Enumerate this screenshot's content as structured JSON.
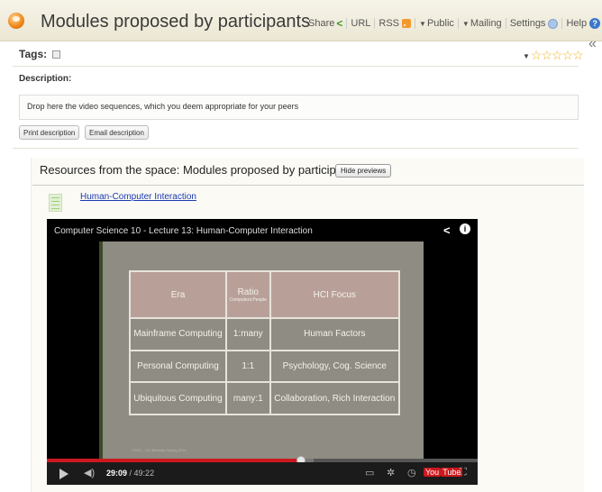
{
  "header": {
    "title": "Modules proposed by participants",
    "toolbar": {
      "share": "Share",
      "url": "URL",
      "rss": "RSS",
      "public": "Public",
      "mailing": "Mailing",
      "settings": "Settings",
      "help": "Help"
    }
  },
  "tags": {
    "label": "Tags:"
  },
  "rating": {
    "stars_filled": 0,
    "stars_total": 5
  },
  "description": {
    "label": "Description:",
    "text": "Drop here the video sequences, which you deem appropriate for your peers",
    "print_button": "Print description",
    "email_button": "Email description"
  },
  "resources": {
    "title": "Resources from the space: Modules proposed by participants",
    "hide_previews_button": "Hide previews",
    "item_link": "Human-Computer Interaction"
  },
  "video": {
    "title": "Computer Science 10 - Lecture 13: Human-Computer Interaction",
    "current_time": "29:09",
    "duration": "/ 49:22",
    "played_fraction": 0.59,
    "buffered_fraction": 0.62,
    "youtube_label": "You",
    "youtube_tube": "Tube",
    "slide": {
      "headers": [
        "Era",
        "Ratio",
        "HCI Focus"
      ],
      "ratio_sub": "Computers:People",
      "rows": [
        [
          "Mainframe Computing",
          "1:many",
          "Human Factors"
        ],
        [
          "Personal Computing",
          "1:1",
          "Psychology, Cog. Science"
        ],
        [
          "Ubiquitous Computing",
          "many:1",
          "Collaboration, Rich Interaction"
        ]
      ],
      "footer": "CS10 – UC Berkeley Spring 2014"
    }
  },
  "colors": {
    "header_bg": "#f1ecdc",
    "link": "#1a3bb4",
    "progress_played": "#cc181e",
    "slide_bg": "#8f8c83",
    "slide_header": "#b8a098"
  }
}
